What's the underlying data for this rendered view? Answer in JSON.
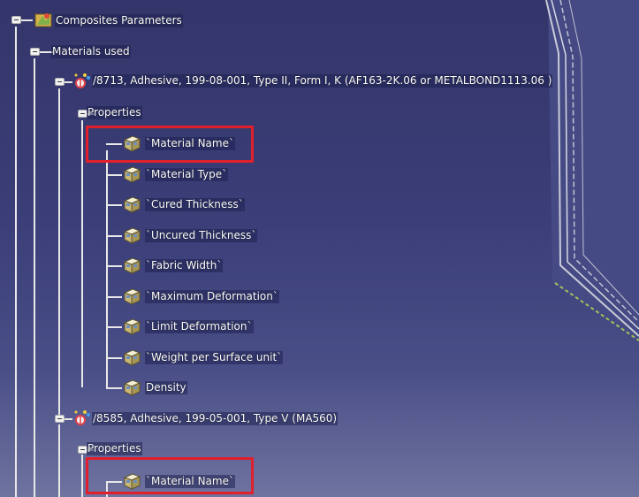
{
  "tree": {
    "root": "Composites Parameters",
    "materials_used": "Materials used",
    "material_1": {
      "label": "/8713, Adhesive, 199-08-001, Type II, Form I, K (AF163-2K.06 or METALBOND1113.06 )",
      "properties_label": "Properties",
      "properties": [
        "`Material Name`",
        "`Material Type`",
        "`Cured Thickness`",
        "`Uncured Thickness`",
        "`Fabric Width`",
        "`Maximum Deformation`",
        "`Limit Deformation`",
        "`Weight per Surface unit`",
        "Density"
      ]
    },
    "material_2": {
      "label": "/8585, Adhesive, 199-05-001, Type V (MA560)",
      "properties_label": "Properties",
      "properties": [
        "`Material Name`"
      ]
    }
  },
  "colors": {
    "highlight": "#e2202c",
    "background_top": "#34356a",
    "background_bottom": "#6f739f"
  },
  "icons": {
    "root": "composites-parameters-icon",
    "material": "material-node-icon",
    "parameter": "parameter-cube-icon"
  }
}
